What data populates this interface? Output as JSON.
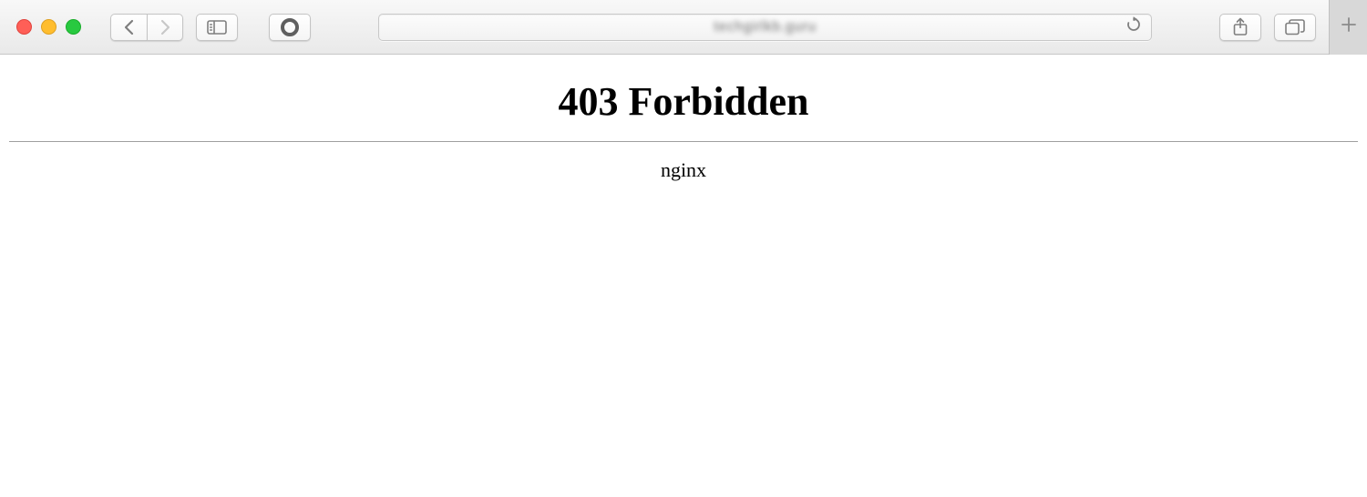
{
  "toolbar": {
    "url_display": "techgirlkb.guru"
  },
  "page": {
    "heading": "403 Forbidden",
    "server": "nginx"
  }
}
